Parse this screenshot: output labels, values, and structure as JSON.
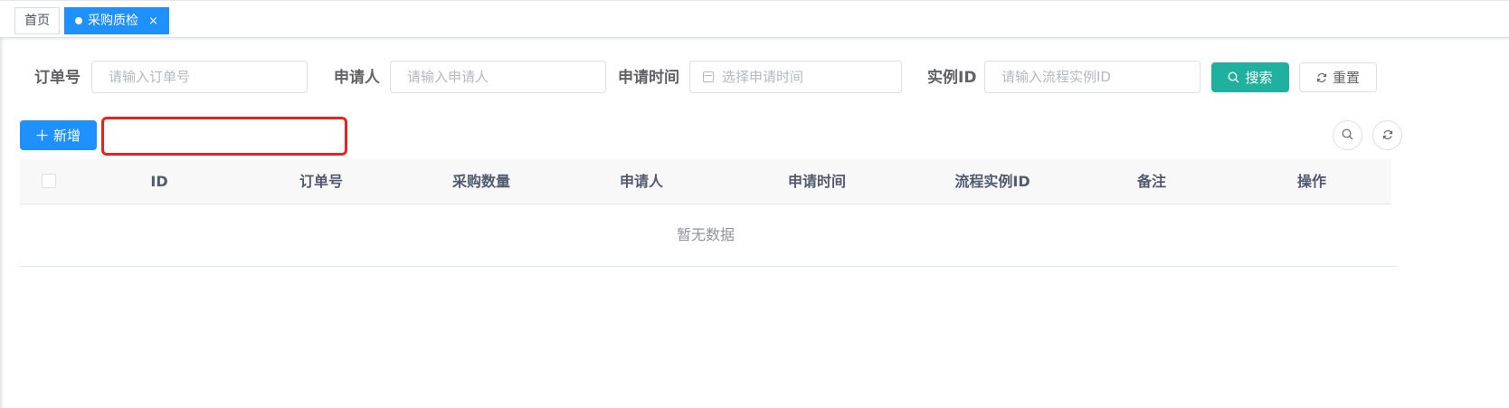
{
  "tabs": {
    "home": "首页",
    "active": "采购质检",
    "close": "×"
  },
  "search": {
    "order_label": "订单号",
    "order_placeholder": "请输入订单号",
    "applicant_label": "申请人",
    "applicant_placeholder": "请输入申请人",
    "time_label": "申请时间",
    "time_placeholder": "选择申请时间",
    "instance_label": "实例ID",
    "instance_placeholder": "请输入流程实例ID",
    "search_button": "搜索",
    "reset_button": "重置"
  },
  "toolbar": {
    "add_button": "新增"
  },
  "table": {
    "columns": [
      "ID",
      "订单号",
      "采购数量",
      "申请人",
      "申请时间",
      "流程实例ID",
      "备注",
      "操作"
    ],
    "empty_text": "暂无数据"
  },
  "colors": {
    "primary": "#1e90ff",
    "search": "#20b09f",
    "highlight": "#e8231f"
  },
  "icons": [
    "search-icon",
    "refresh-icon",
    "plus-icon",
    "calendar-icon",
    "close-icon"
  ]
}
